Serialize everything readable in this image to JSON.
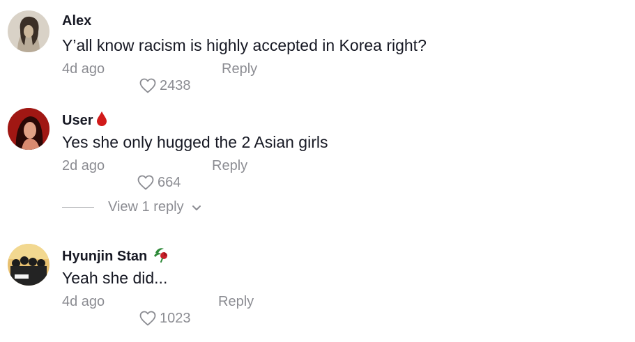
{
  "comments": [
    {
      "username": "Alex",
      "text": "Y’all know racism is highly accepted in Korea right?",
      "time": "4d ago",
      "likes": "2438",
      "reply_label": "Reply"
    },
    {
      "username": "User",
      "badge_icon": "blood-drop-icon",
      "text": "Yes she only hugged the 2 Asian girls",
      "time": "2d ago",
      "likes": "664",
      "reply_label": "Reply",
      "view_replies_label": "View 1 reply"
    },
    {
      "username": "Hyunjin Stan",
      "badge_icon": "rose-icon",
      "text": "Yeah she did...",
      "time": "4d ago",
      "likes": "1023",
      "reply_label": "Reply"
    }
  ],
  "colors": {
    "text_primary": "#161823",
    "text_secondary": "#8a8b91",
    "blood_drop": "#d11a1a"
  }
}
